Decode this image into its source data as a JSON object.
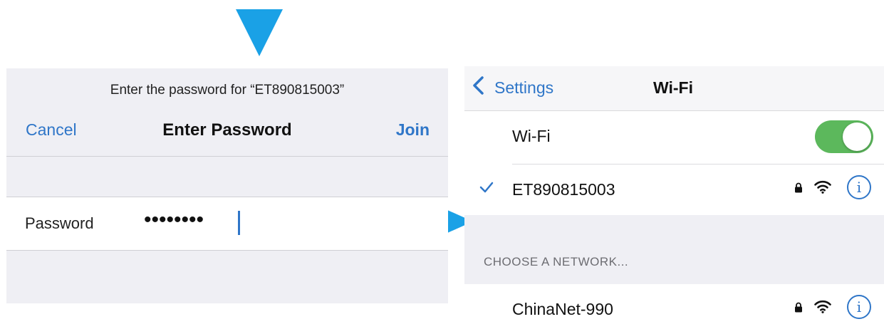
{
  "password_prompt": {
    "message": "Enter the password for “ET890815003”",
    "cancel_label": "Cancel",
    "title": "Enter Password",
    "join_label": "Join",
    "password_label": "Password",
    "password_value": "••••••••"
  },
  "wifi_screen": {
    "back_label": "Settings",
    "title": "Wi-Fi",
    "wifi_toggle_label": "Wi-Fi",
    "wifi_enabled": true,
    "connected_network": "ET890815003",
    "section_header": "CHOOSE A NETWORK...",
    "networks": [
      {
        "name": "ChinaNet-990",
        "secured": true
      }
    ]
  },
  "icons": {
    "arrow_down": "arrow-down-icon",
    "arrow_right": "arrow-right-icon",
    "back": "chevron-left-icon",
    "check": "checkmark-icon",
    "lock": "lock-icon",
    "wifi": "wifi-signal-icon",
    "info": "info-icon",
    "info_glyph": "i"
  },
  "colors": {
    "accent": "#2f76c8",
    "arrow": "#1aa1e6",
    "toggle_on": "#5cb85c",
    "group_background": "#efeff4"
  }
}
